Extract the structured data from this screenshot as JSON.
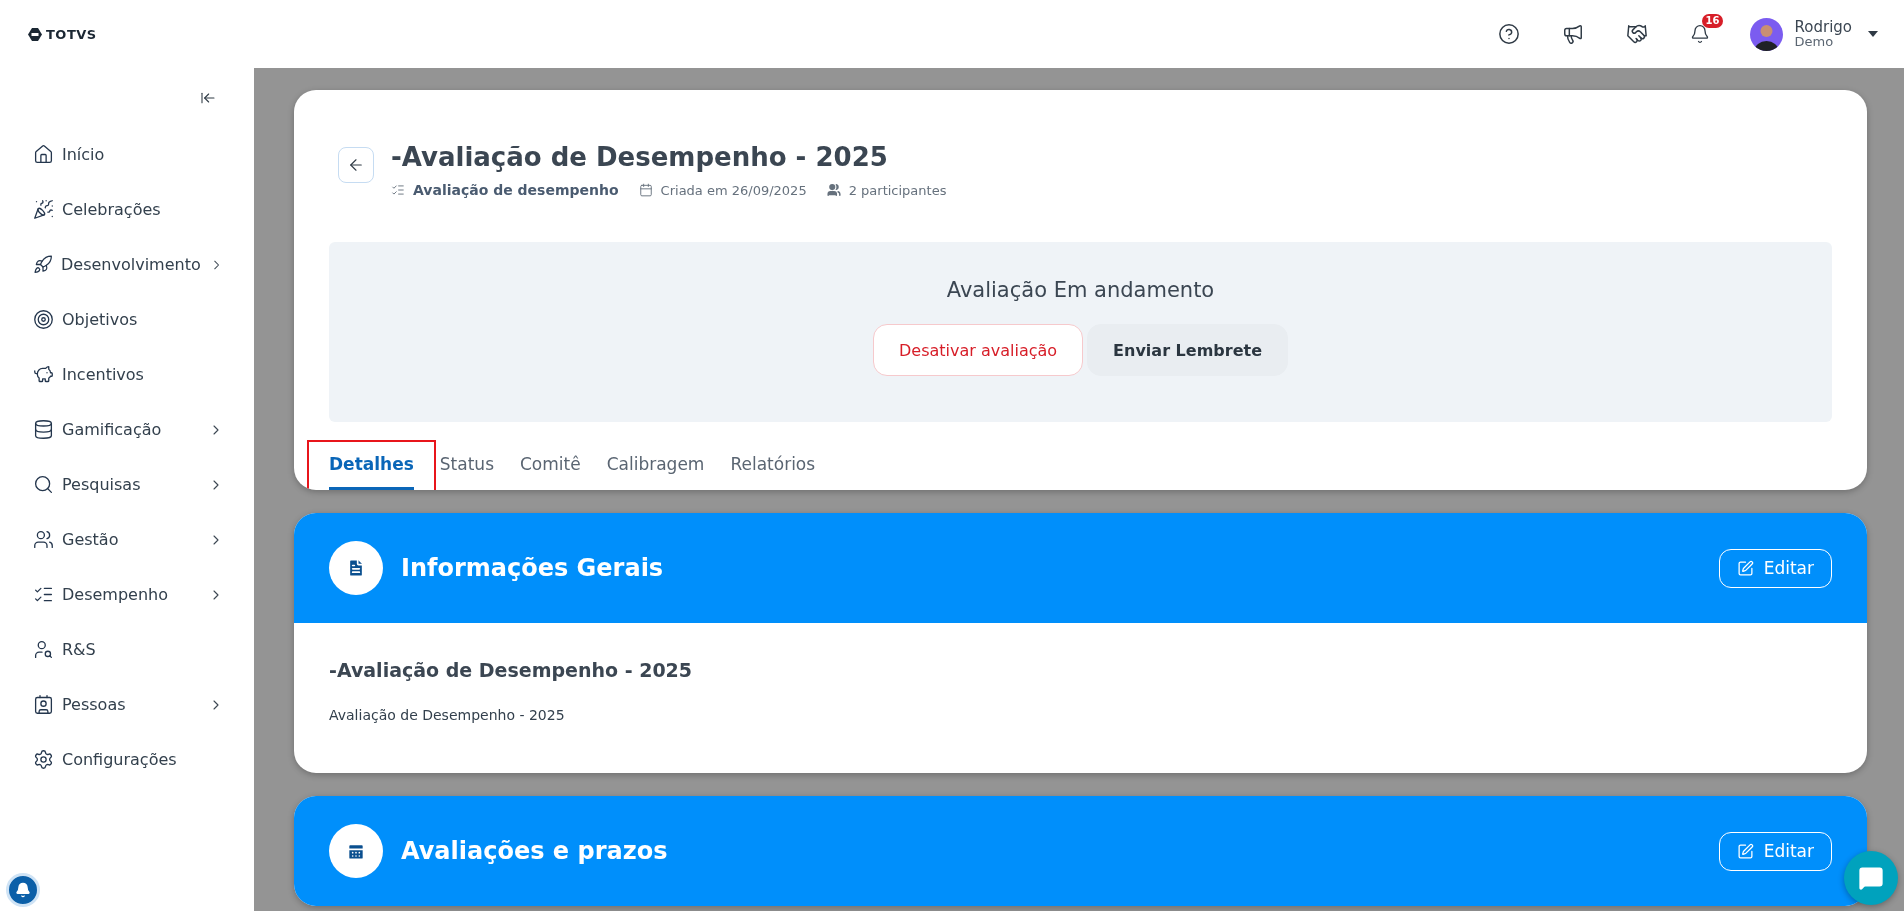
{
  "header": {
    "logo": "TOTVS",
    "notifications_count": "16",
    "user": {
      "name": "Rodrigo",
      "role": "Demo"
    }
  },
  "sidebar": {
    "items": [
      {
        "label": "Início",
        "expandable": false
      },
      {
        "label": "Celebrações",
        "expandable": false
      },
      {
        "label": "Desenvolvimento",
        "expandable": true
      },
      {
        "label": "Objetivos",
        "expandable": false
      },
      {
        "label": "Incentivos",
        "expandable": false
      },
      {
        "label": "Gamificação",
        "expandable": true
      },
      {
        "label": "Pesquisas",
        "expandable": true
      },
      {
        "label": "Gestão",
        "expandable": true
      },
      {
        "label": "Desempenho",
        "expandable": true
      },
      {
        "label": "R&S",
        "expandable": false
      },
      {
        "label": "Pessoas",
        "expandable": true
      },
      {
        "label": "Configurações",
        "expandable": false
      }
    ]
  },
  "page": {
    "title": "-Avaliação de Desempenho - 2025",
    "meta": [
      {
        "kind": "type",
        "text": "Avaliação de desempenho"
      },
      {
        "kind": "date",
        "text": "Criada em 26/09/2025"
      },
      {
        "kind": "participants",
        "text": "2 participantes"
      }
    ],
    "status": {
      "heading": "Avaliação Em andamento",
      "buttons": [
        {
          "kind": "danger",
          "label": "Desativar avaliação"
        },
        {
          "kind": "neutral",
          "label": "Enviar Lembrete"
        }
      ]
    },
    "tabs": [
      {
        "label": "Detalhes",
        "selected": true,
        "highlighted": true
      },
      {
        "label": "Status",
        "selected": false,
        "highlighted": false
      },
      {
        "label": "Comitê",
        "selected": false,
        "highlighted": false
      },
      {
        "label": "Calibragem",
        "selected": false,
        "highlighted": false
      },
      {
        "label": "Relatórios",
        "selected": false,
        "highlighted": false
      }
    ]
  },
  "sections": [
    {
      "title": "Informações Gerais",
      "action": "Editar",
      "heading": "-Avaliação de Desempenho - 2025",
      "text": "Avaliação de Desempenho - 2025"
    },
    {
      "title": "Avaliações e prazos",
      "action": "Editar"
    }
  ]
}
